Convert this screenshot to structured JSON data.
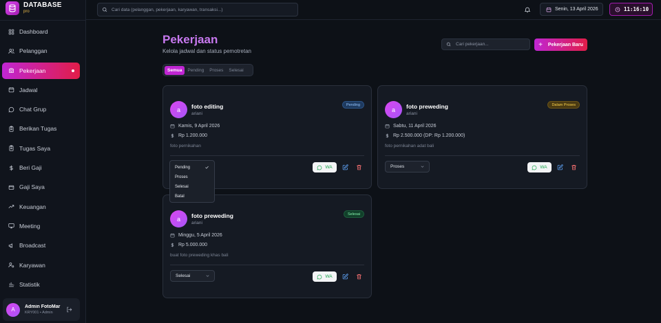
{
  "brand": {
    "name": "DATABASE",
    "sub": "pro"
  },
  "sidebar": {
    "items": [
      {
        "label": "Dashboard",
        "icon": "grid-icon"
      },
      {
        "label": "Pelanggan",
        "icon": "users-icon"
      },
      {
        "label": "Pekerjaan",
        "icon": "camera-icon",
        "active": true
      },
      {
        "label": "Jadwal",
        "icon": "calendar-icon"
      },
      {
        "label": "Chat Grup",
        "icon": "chat-icon"
      },
      {
        "label": "Berikan Tugas",
        "icon": "clipboard-icon"
      },
      {
        "label": "Tugas Saya",
        "icon": "clipboard-icon"
      },
      {
        "label": "Beri Gaji",
        "icon": "dollar-icon"
      },
      {
        "label": "Gaji Saya",
        "icon": "wallet-icon"
      },
      {
        "label": "Keuangan",
        "icon": "trending-icon"
      },
      {
        "label": "Meeting",
        "icon": "monitor-icon"
      },
      {
        "label": "Broadcast",
        "icon": "megaphone-icon"
      },
      {
        "label": "Karyawan",
        "icon": "user-cog-icon"
      },
      {
        "label": "Statistik",
        "icon": "bar-chart-icon"
      }
    ],
    "user": {
      "initial": "A",
      "name": "Admin FotoMar",
      "role": "KRY001 • Admin"
    }
  },
  "topbar": {
    "search_placeholder": "Cari data (pelanggan, pekerjaan, karyawan, transaksi...)",
    "date": "Senin, 13 April 2026",
    "time": "11:16:10"
  },
  "page": {
    "title": "Pekerjaan",
    "subtitle": "Kelola jadwal dan status pemotretan",
    "search_placeholder": "Cari pekerjaan...",
    "new_button": "Pekerjaan Baru",
    "tabs": [
      "Semua",
      "Pending",
      "Proses",
      "Selesai"
    ],
    "active_tab": "Semua"
  },
  "jobs": [
    {
      "initial": "a",
      "title": "foto editing",
      "client": "ariani",
      "status": "Pending",
      "date": "Kamis, 9 April 2026",
      "price": "Rp 1.200.000",
      "note": "foto pernikahan",
      "select": "Pending",
      "wa": "WA"
    },
    {
      "initial": "a",
      "title": "foto preweding",
      "client": "ariani",
      "status": "Dalam Proses",
      "date": "Sabtu, 11 April 2026",
      "price": "Rp 2.500.000 (DP: Rp 1.200.000)",
      "note": "foto pernikahan adat bali",
      "select": "Proses",
      "wa": "WA"
    },
    {
      "initial": "a",
      "title": "foto preweding",
      "client": "ariani",
      "status": "Selesai",
      "date": "Minggu, 5 April 2026",
      "price": "Rp 5.000.000",
      "note": "buat foto preweding khas bali",
      "select": "Selesai",
      "wa": "WA"
    }
  ],
  "dropdown": {
    "options": [
      "Pending",
      "Proses",
      "Selesai",
      "Batal"
    ],
    "selected": "Pending"
  },
  "colors": {
    "accent": "#c026d3",
    "accent2": "#e11d48",
    "background": "#0d1117",
    "card": "#151a23"
  }
}
